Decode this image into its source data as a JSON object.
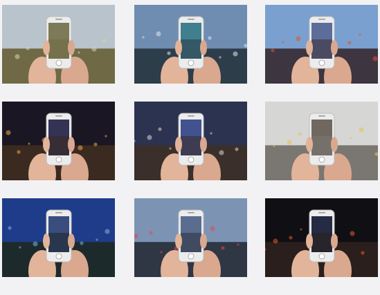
{
  "page": {
    "background": "#f2f2f4"
  },
  "photos": [
    {
      "id": "parthenon-daytime",
      "sky": "#b9c3cc",
      "ground": "#6f6a45",
      "screen": "#7c7a58",
      "accent": "#d8cfae"
    },
    {
      "id": "pedestrian-bridge",
      "sky": "#6f8db0",
      "ground": "#2d3d4a",
      "screen": "#3f7f8e",
      "accent": "#dfe6ee"
    },
    {
      "id": "street-dusk",
      "sky": "#7aa0cf",
      "ground": "#3d3540",
      "screen": "#5d6d9a",
      "accent": "#e3502e"
    },
    {
      "id": "city-night-skyline",
      "sky": "#1a1623",
      "ground": "#3b2a1f",
      "screen": "#343255",
      "accent": "#f0a94a"
    },
    {
      "id": "ryman-facade-night",
      "sky": "#2b3350",
      "ground": "#3a2f2a",
      "screen": "#41528f",
      "accent": "#d8d5cc"
    },
    {
      "id": "bus-depot-day",
      "sky": "#d6d6d4",
      "ground": "#7a7772",
      "screen": "#6f6760",
      "accent": "#e8c35b"
    },
    {
      "id": "riverfront-fountain",
      "sky": "#1f3c8a",
      "ground": "#1c2a2c",
      "screen": "#3a4d7e",
      "accent": "#7fb1d9"
    },
    {
      "id": "downtown-twilight",
      "sky": "#7d93b4",
      "ground": "#2f3644",
      "screen": "#5a6d8e",
      "accent": "#d84d4d"
    },
    {
      "id": "neon-sign-night",
      "sky": "#0f0f14",
      "ground": "#2a1f1c",
      "screen": "#252b44",
      "accent": "#e55a29"
    }
  ]
}
